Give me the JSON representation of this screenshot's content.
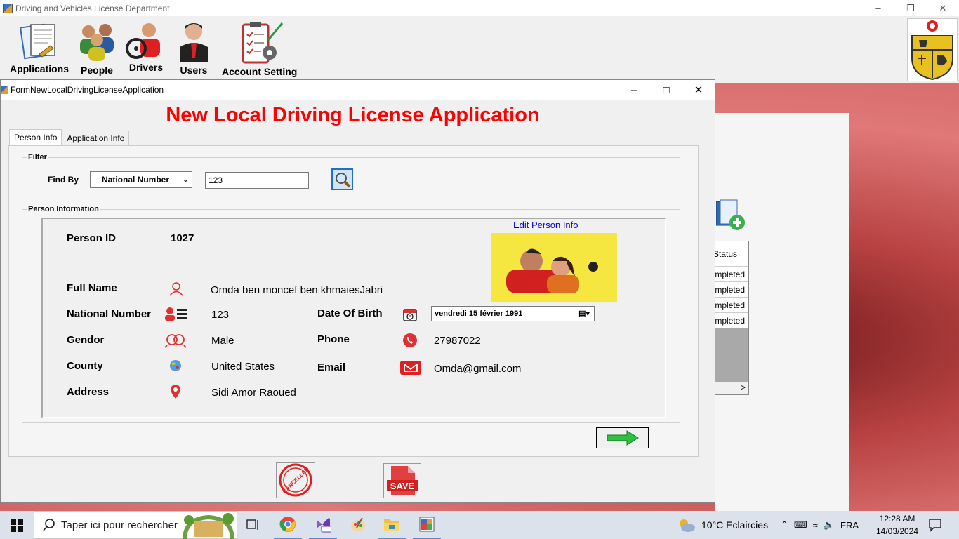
{
  "main_window": {
    "title": "Driving and Vehicles License Department"
  },
  "menu": {
    "items": [
      "Applications",
      "People",
      "Drivers",
      "Users",
      "Account Setting"
    ]
  },
  "background_grid": {
    "header": "Status",
    "cells": [
      "Completed",
      "Completed",
      "Completed",
      "Completed"
    ],
    "scroll_arrow": ">"
  },
  "dialog": {
    "title": "FormNewLocalDrivingLicenseApplication",
    "heading": "New Local Driving License Application",
    "tabs": [
      "Person Info",
      "Application Info"
    ],
    "filter": {
      "legend": "Filter",
      "find_by_label": "Find By",
      "find_by_value": "National Number",
      "search_value": "123"
    },
    "person": {
      "legend": "Person Information",
      "edit_link": "Edit Person Info",
      "person_id_label": "Person ID",
      "person_id": "1027",
      "full_name_label": "Full Name",
      "full_name": "Omda ben moncef ben khmaiesJabri",
      "national_number_label": "National Number",
      "national_number": "123",
      "gender_label": "Gendor",
      "gender": "Male",
      "country_label": "County",
      "country": "United States",
      "address_label": "Address",
      "address": "Sidi Amor Raoued",
      "dob_label": "Date Of Birth",
      "dob": "vendredi  15     février     1991",
      "phone_label": "Phone",
      "phone": "27987022",
      "email_label": "Email",
      "email": "Omda@gmail.com"
    },
    "cancel_stamp": "CANCELLED",
    "save_label": "SAVE"
  },
  "taskbar": {
    "search_placeholder": "Taper ici pour rechercher",
    "weather": "10°C  Eclaircies",
    "lang": "FRA",
    "time": "12:28 AM",
    "date": "14/03/2024"
  },
  "colors": {
    "heading": "#ff0000",
    "link": "#0000ee",
    "accent": "#1e6fd0"
  }
}
